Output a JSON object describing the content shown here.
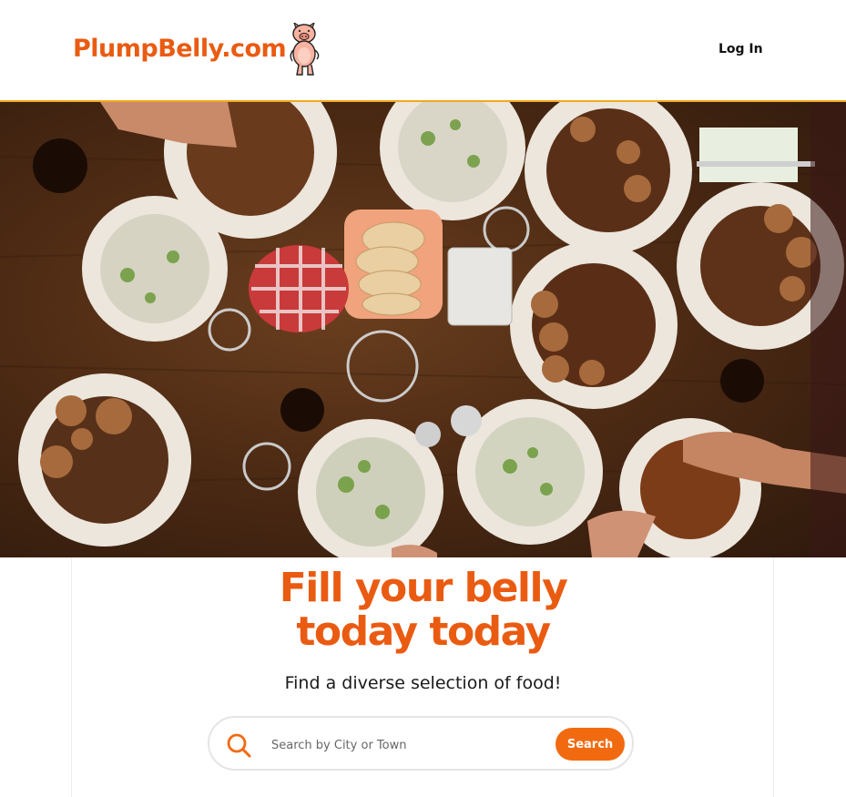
{
  "header": {
    "brand": "PlumpBelly.com",
    "login_label": "Log In",
    "logo_icon": "pig-mascot-icon"
  },
  "hero": {
    "image_icon": "table-food-photo"
  },
  "main": {
    "headline": "Fill your belly today today",
    "subhead": "Find a diverse selection of food!"
  },
  "search": {
    "icon": "search-icon",
    "placeholder": "Search by City or Town",
    "value": "",
    "button_label": "Search"
  },
  "colors": {
    "accent": "#ea5b12",
    "button": "#f26a10",
    "header_border": "#f2a91f"
  }
}
